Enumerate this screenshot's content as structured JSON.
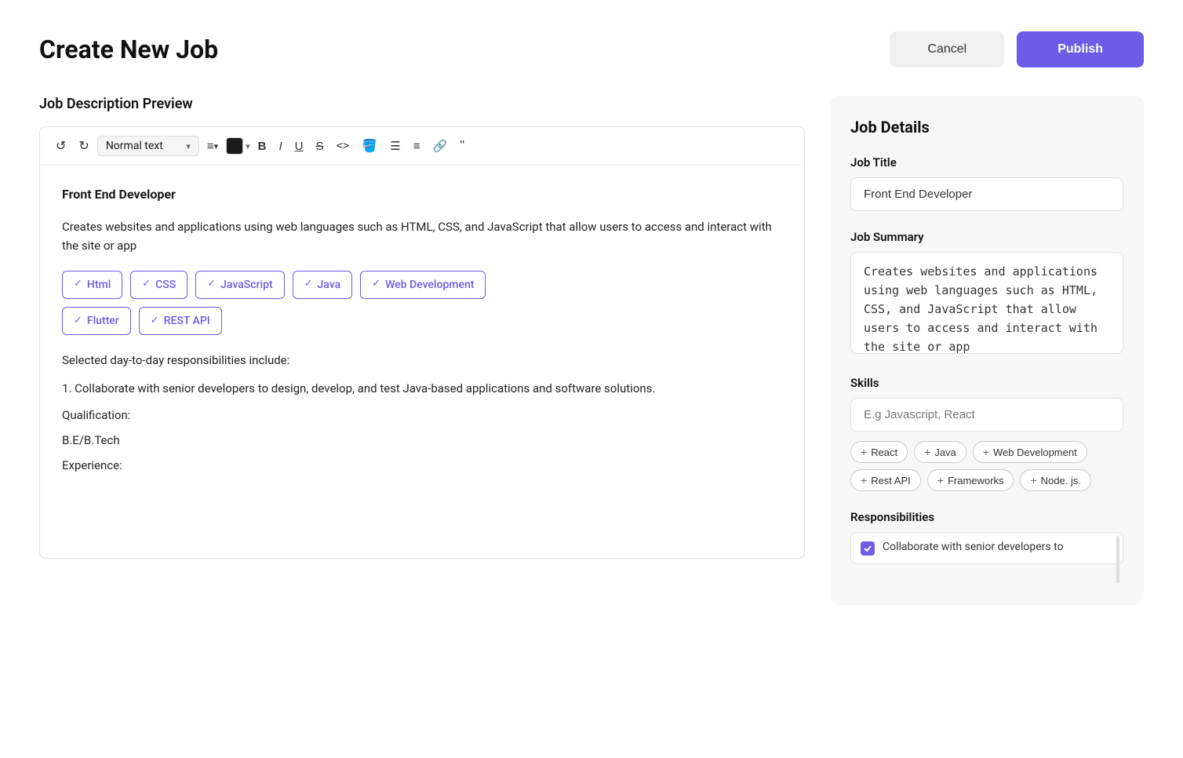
{
  "header": {
    "title": "Create New Job",
    "cancel_label": "Cancel",
    "publish_label": "Publish"
  },
  "editor": {
    "section_title": "Job Description Preview",
    "toolbar": {
      "text_style": "Normal text",
      "text_style_chevron": "▾",
      "align_chevron": "▾",
      "color_hex": "#1a1a1a",
      "color_chevron": "▾",
      "bold": "B",
      "italic": "I",
      "underline": "U",
      "strikethrough": "S",
      "code": "<>",
      "eraser": "✕",
      "bullet_list": "≡",
      "numbered_list": "≡",
      "link": "🔗",
      "quote": "“”"
    },
    "content": {
      "job_title": "Front End Developer",
      "summary": "Creates websites and applications using web languages such as HTML, CSS, and JavaScript that allow users to access and interact with the site or app",
      "skills": [
        "Html",
        "CSS",
        "JavaScript",
        "Java",
        "Web Development",
        "Flutter",
        "REST API"
      ],
      "responsibilities_intro": "Selected day-to-day responsibilities include:",
      "responsibility_1": "1. Collaborate with senior developers to design, develop, and test Java-based applications and software solutions.",
      "qualification_label": "Qualification:",
      "qualification_value": "B.E/B.Tech",
      "experience_label": "Experience:"
    }
  },
  "sidebar": {
    "title": "Job Details",
    "job_title_label": "Job Title",
    "job_title_value": "Front End Developer",
    "job_summary_label": "Job Summary",
    "job_summary_value": "Creates websites and applications using web languages such as HTML, CSS, and JavaScript that allow users to access and interact with the site or app",
    "skills_label": "Skills",
    "skills_placeholder": "E.g Javascript, React",
    "skill_suggestions": [
      "React",
      "Java",
      "Web Development",
      "Rest API",
      "Frameworks",
      "Node. js."
    ],
    "responsibilities_label": "Responsibilities",
    "responsibility_preview": "Collaborate with senior developers to"
  }
}
